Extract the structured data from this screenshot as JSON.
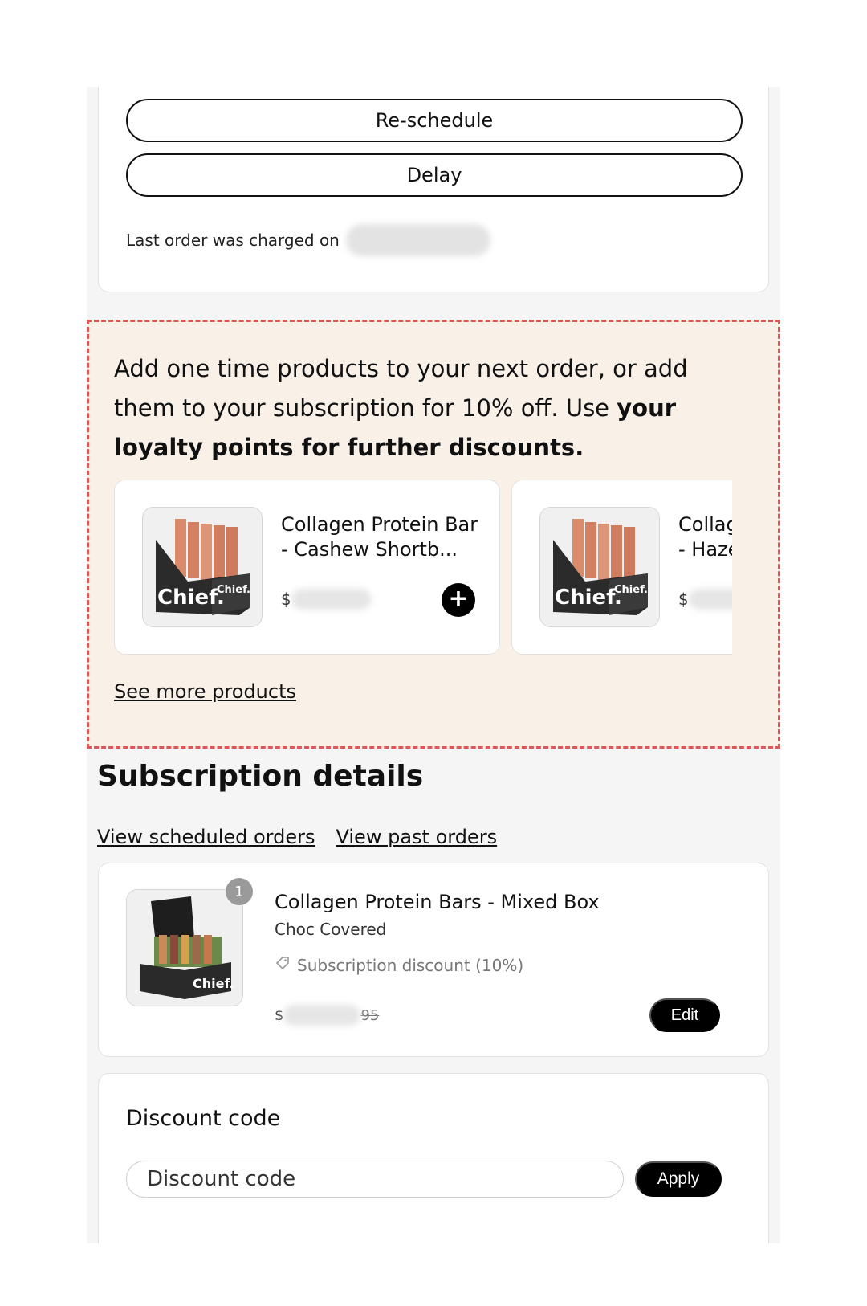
{
  "actions": {
    "reschedule_label": "Re-schedule",
    "delay_label": "Delay"
  },
  "last_order": {
    "label": "Last order was charged on"
  },
  "promo": {
    "text_regular": "Add one time products to your next order, or add them to your subscription for 10% off. Use ",
    "text_bold": "your loyalty points for further discounts.",
    "products": [
      {
        "name": "Collagen Protein Bar - Cashew Shortb...",
        "price_prefix": "$",
        "brand": "Chief."
      },
      {
        "name": "Collagen Protein Bar - Hazelnut...",
        "price_prefix": "$",
        "brand": "Chief."
      }
    ],
    "add_icon": "plus-icon",
    "see_more": "See more products"
  },
  "subscription": {
    "title": "Subscription details",
    "link_scheduled": "View scheduled orders",
    "link_past": "View past orders",
    "item": {
      "quantity": "1",
      "name": "Collagen Protein Bars - Mixed Box",
      "variant": "Choc Covered",
      "discount": "Subscription discount (10%)",
      "price_prefix": "$",
      "price_suffix": "95",
      "edit_label": "Edit",
      "brand": "Chief."
    }
  },
  "discount": {
    "title": "Discount code",
    "placeholder": "Discount code",
    "apply_label": "Apply"
  },
  "colors": {
    "promo_bg": "#f9f1e8",
    "promo_border": "#e05555",
    "page_bg": "#f5f5f5"
  }
}
